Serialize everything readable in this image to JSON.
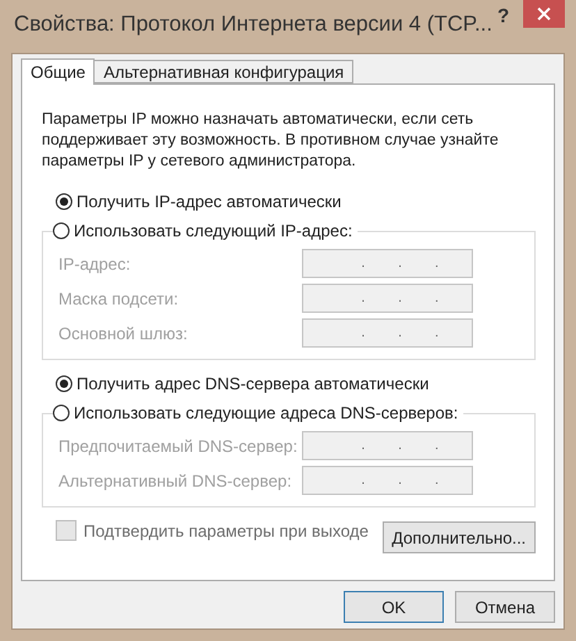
{
  "window": {
    "title": "Свойства: Протокол Интернета версии 4 (TCP..."
  },
  "help_button": "?",
  "tabs": [
    {
      "label": "Общие",
      "selected": true
    },
    {
      "label": "Альтернативная конфигурация",
      "selected": false
    }
  ],
  "description": "Параметры IP можно назначать автоматически, если сеть поддерживает эту возможность. В противном случае узнайте параметры IP у сетевого администратора.",
  "groups": [
    {
      "auto_option": {
        "label": "Получить IP-адрес автоматически",
        "selected": true
      },
      "manual_option": {
        "label": "Использовать следующий IP-адрес:",
        "selected": false
      },
      "fields": [
        {
          "label": "IP-адрес:",
          "disabled": true,
          "separators": [
            ".",
            ".",
            "."
          ]
        },
        {
          "label": "Маска подсети:",
          "disabled": true,
          "separators": [
            ".",
            ".",
            "."
          ]
        },
        {
          "label": "Основной шлюз:",
          "disabled": true,
          "separators": [
            ".",
            ".",
            "."
          ]
        }
      ]
    },
    {
      "auto_option": {
        "label": "Получить адрес DNS-сервера автоматически",
        "selected": true
      },
      "manual_option": {
        "label": "Использовать следующие адреса DNS-серверов:",
        "selected": false
      },
      "fields": [
        {
          "label": "Предпочитаемый DNS-сервер:",
          "disabled": true,
          "separators": [
            ".",
            ".",
            "."
          ]
        },
        {
          "label": "Альтернативный DNS-сервер:",
          "disabled": true,
          "separators": [
            ".",
            ".",
            "."
          ]
        }
      ]
    }
  ],
  "confirm_checkbox": {
    "label": "Подтвердить параметры при выходе",
    "checked": false,
    "disabled": true
  },
  "advanced_button": "Дополнительно...",
  "buttons": [
    {
      "label": "OK",
      "default": true
    },
    {
      "label": "Отмена",
      "default": false
    }
  ]
}
